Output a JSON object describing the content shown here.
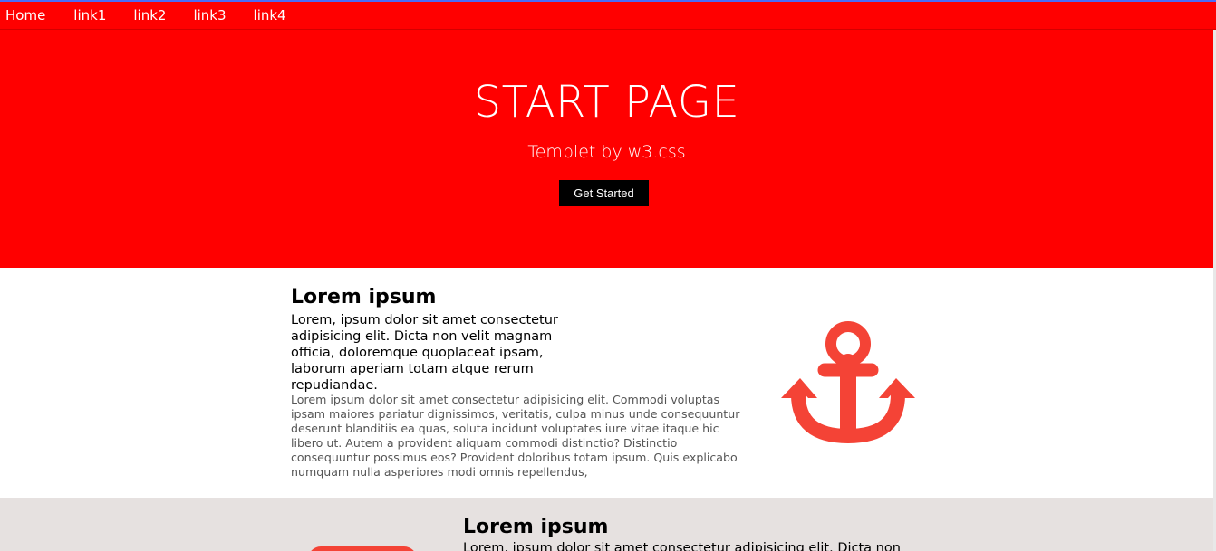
{
  "nav": {
    "items": [
      {
        "label": "Home"
      },
      {
        "label": "link1"
      },
      {
        "label": "link2"
      },
      {
        "label": "link3"
      },
      {
        "label": "link4"
      }
    ]
  },
  "hero": {
    "title": "START PAGE",
    "subtitle": "Templet by w3.css",
    "button_label": "Get Started"
  },
  "section1": {
    "heading": "Lorem ipsum",
    "lead": "Lorem, ipsum dolor sit amet consectetur adipisicing elit. Dicta non velit magnam officia, doloremque quoplaceat ipsam, laborum aperiam totam atque rerum repudiandae.",
    "body": "Lorem ipsum dolor sit amet consectetur adipisicing elit. Commodi voluptas ipsam maiores pariatur dignissimos, veritatis, culpa minus unde consequuntur deserunt blanditiis ea quas, soluta incidunt voluptates iure vitae itaque hic libero ut. Autem a provident aliquam commodi distinctio? Distinctio consequuntur possimus eos? Provident doloribus totam ipsum. Quis explicabo numquam nulla asperiores modi omnis repellendus,",
    "icon": "anchor-icon",
    "icon_color": "#f44336"
  },
  "section2": {
    "heading": "Lorem ipsum",
    "text": "Lorem, ipsum dolor sit amet consectetur adipisicing elit. Dicta non",
    "background": "#e6e1e0"
  },
  "colors": {
    "primary": "#ff0000",
    "button": "#000000",
    "accent": "#f44336"
  }
}
